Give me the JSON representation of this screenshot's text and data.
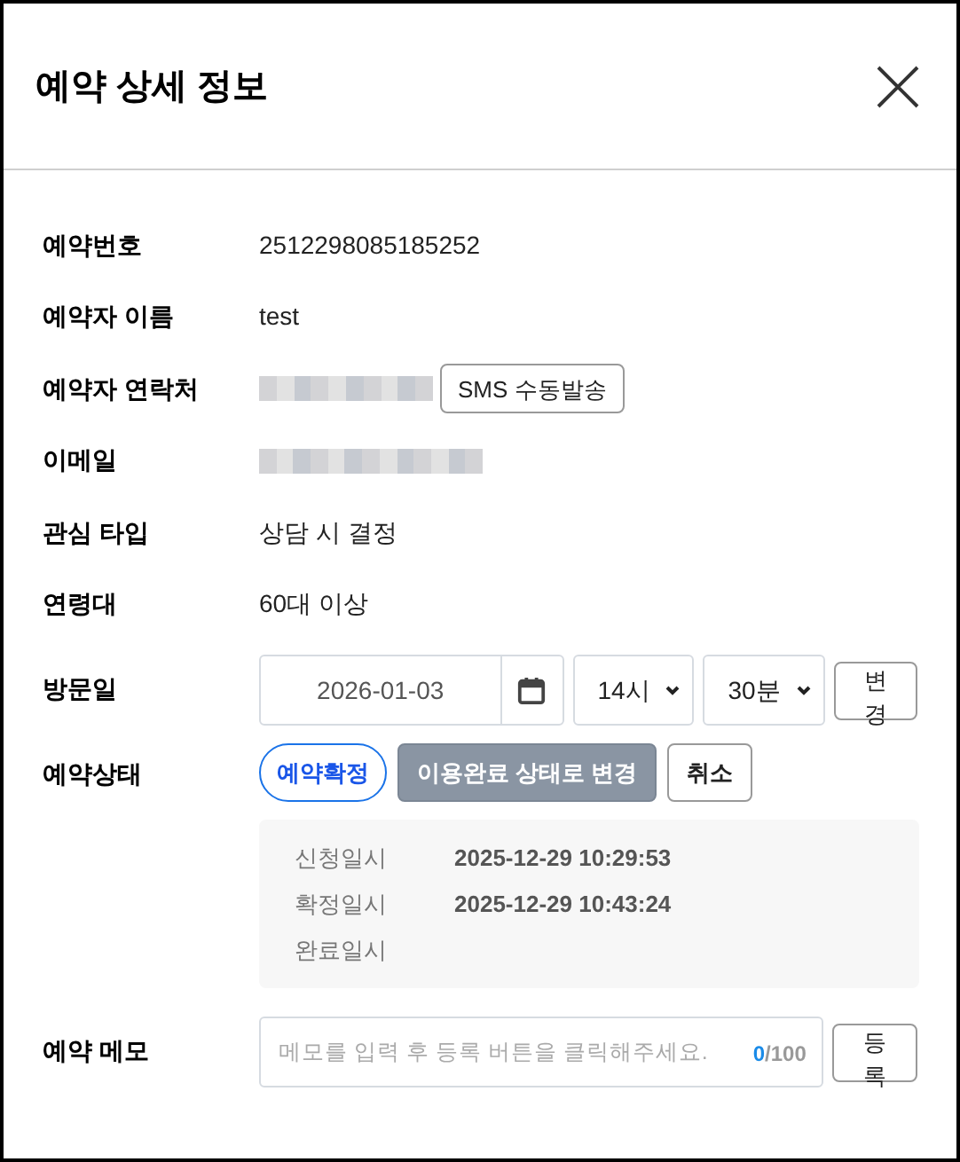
{
  "modal": {
    "title": "예약 상세 정보"
  },
  "fields": [
    {
      "kind": "text",
      "label": "예약번호",
      "value": "2512298085185252"
    },
    {
      "kind": "text",
      "label": "예약자 이름",
      "value": "test"
    },
    {
      "kind": "redacted_button",
      "label": "예약자 연락처",
      "button": "SMS 수동발송"
    },
    {
      "kind": "redacted",
      "label": "이메일"
    },
    {
      "kind": "text",
      "label": "관심 타입",
      "value": "상담 시 결정"
    },
    {
      "kind": "text",
      "label": "연령대",
      "value": "60대 이상"
    }
  ],
  "visit": {
    "label": "방문일",
    "date": "2026-01-03",
    "hour": "14시",
    "minute": "30분",
    "button": "변경"
  },
  "status": {
    "label": "예약상태",
    "current": "예약확정",
    "actions": [
      {
        "kind": "filled",
        "label": "이용완료 상태로 변경"
      },
      {
        "kind": "outline",
        "label": "취소"
      }
    ],
    "history": [
      {
        "label": "신청일시",
        "value": "2025-12-29 10:29:53"
      },
      {
        "label": "확정일시",
        "value": "2025-12-29 10:43:24"
      },
      {
        "label": "완료일시"
      }
    ]
  },
  "memo": {
    "label": "예약 메모",
    "placeholder": "메모를 입력 후 등록 버튼을 클릭해주세요.",
    "count": "0",
    "max": "/100",
    "button": "등록"
  }
}
